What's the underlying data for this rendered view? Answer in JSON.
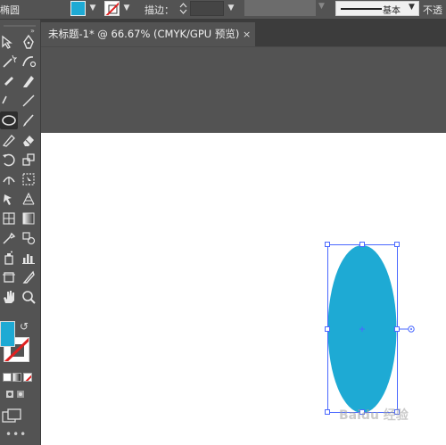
{
  "colors": {
    "fill": "#1eaad4",
    "selection": "#4a68ff",
    "ui_bg": "#535353"
  },
  "control_bar": {
    "left_label": "椭圆",
    "stroke_label": "描边：",
    "profile_label": "基本",
    "opacity_label": "不透"
  },
  "document": {
    "tab_title": "未标题-1* @ 66.67% (CMYK/GPU 预览)",
    "close_glyph": "×"
  },
  "canvas": {
    "shape": "ellipse",
    "shape_fill": "#1eaad4",
    "selected": true
  },
  "watermark": "Baidu 经验"
}
